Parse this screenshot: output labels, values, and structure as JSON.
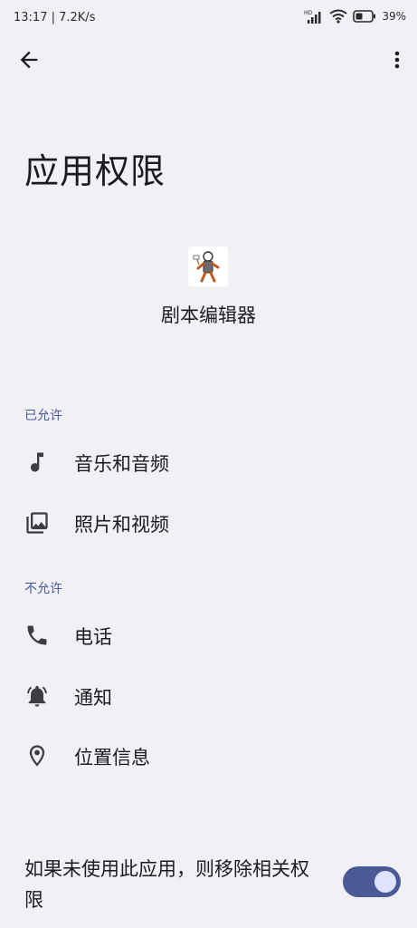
{
  "status_bar": {
    "time_speed": "13:17 | 7.2K/s",
    "hd_label": "HD",
    "battery": "39%"
  },
  "toolbar": {
    "back_icon": "arrow-back-icon",
    "more_icon": "more-vert-icon"
  },
  "page": {
    "title": "应用权限"
  },
  "app": {
    "name": "剧本编辑器",
    "icon": "app-icon"
  },
  "allowed": {
    "header": "已允许",
    "items": [
      {
        "label": "音乐和音频",
        "icon": "music-note-icon"
      },
      {
        "label": "照片和视频",
        "icon": "photo-library-icon"
      }
    ]
  },
  "denied": {
    "header": "不允许",
    "items": [
      {
        "label": "电话",
        "icon": "phone-icon"
      },
      {
        "label": "通知",
        "icon": "notification-bell-icon"
      },
      {
        "label": "位置信息",
        "icon": "location-pin-icon"
      }
    ]
  },
  "remove_permissions": {
    "label": "如果未使用此应用，则移除相关权限",
    "enabled": true
  },
  "colors": {
    "background": "#f1f0f5",
    "accent": "#4a5a96",
    "section_header": "#4a5aa0"
  }
}
